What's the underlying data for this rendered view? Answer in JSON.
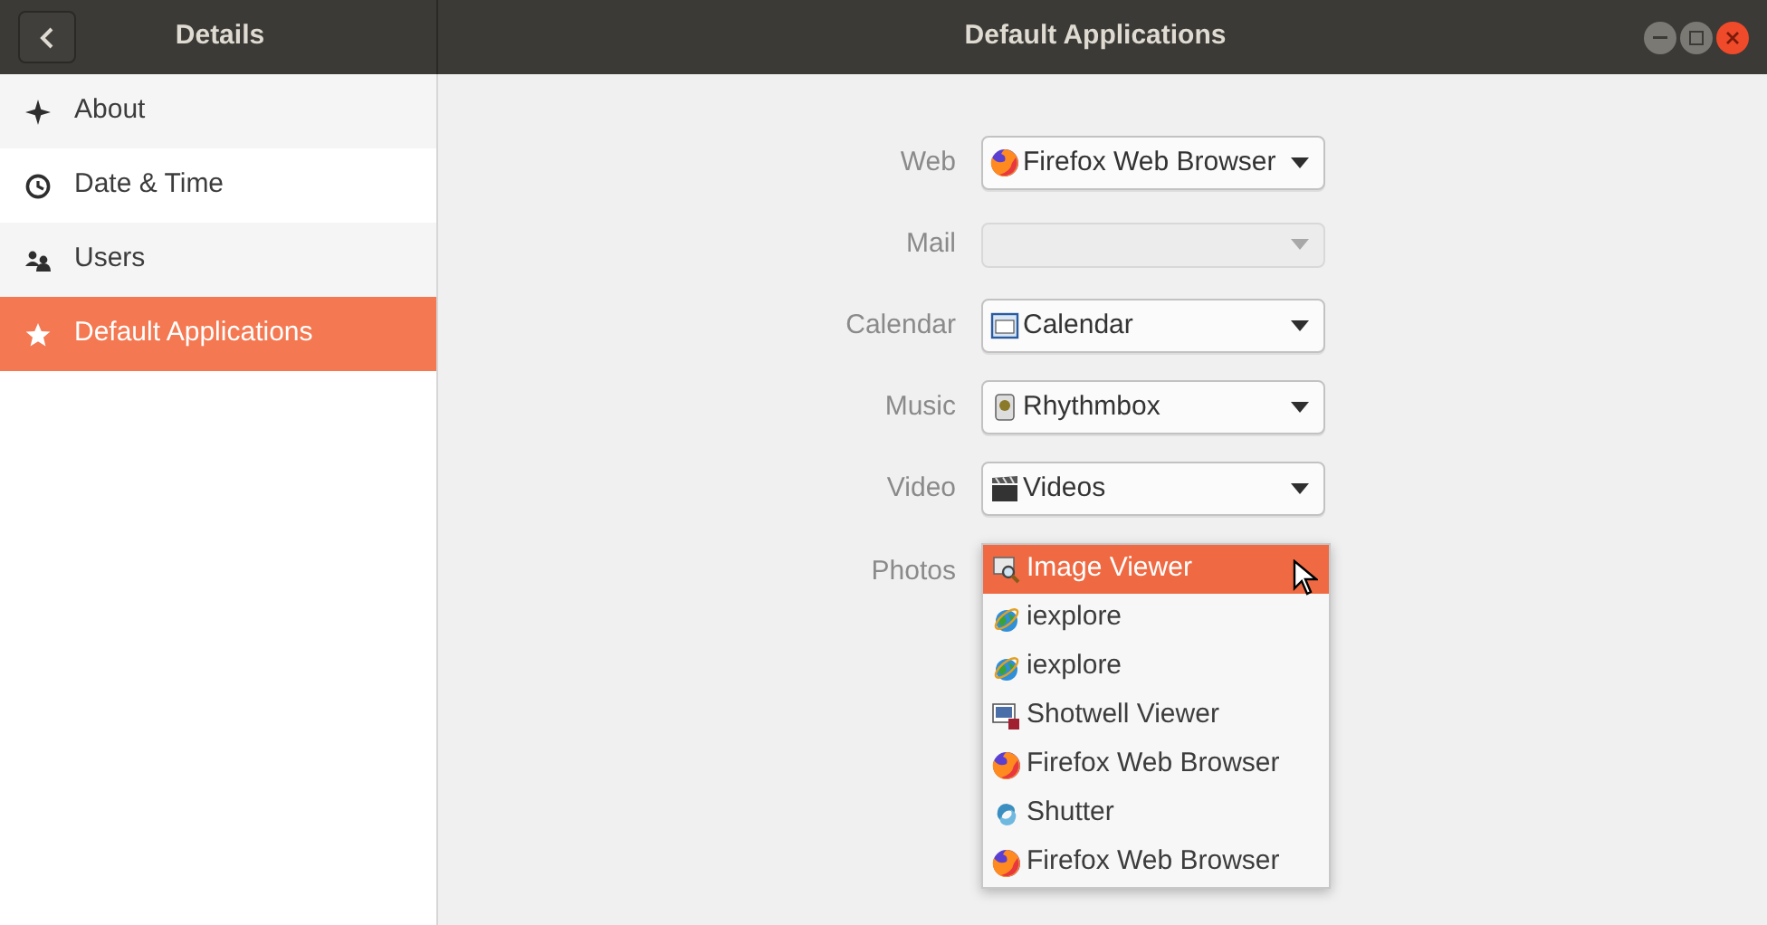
{
  "sidebar": {
    "title": "Details",
    "items": [
      {
        "label": "About",
        "kind": "sparkle",
        "selected": false
      },
      {
        "label": "Date & Time",
        "kind": "clock",
        "selected": false
      },
      {
        "label": "Users",
        "kind": "people",
        "selected": false
      },
      {
        "label": "Default Applications",
        "kind": "star",
        "selected": true
      }
    ]
  },
  "window": {
    "title": "Default Applications"
  },
  "settings": [
    {
      "label": "Web",
      "value": "Firefox Web Browser",
      "kind": "globe",
      "disabled": false
    },
    {
      "label": "Mail",
      "disabled": true
    },
    {
      "label": "Calendar",
      "value": "Calendar",
      "kind": "calendar",
      "disabled": false
    },
    {
      "label": "Music",
      "value": "Rhythmbox",
      "kind": "speaker",
      "disabled": false
    },
    {
      "label": "Video",
      "value": "Videos",
      "kind": "clapper",
      "disabled": false
    }
  ],
  "photos": {
    "label": "Photos",
    "options": [
      {
        "label": "Image Viewer",
        "kind": "magnifier",
        "selected": true
      },
      {
        "label": "iexplore",
        "kind": "earth",
        "selected": false
      },
      {
        "label": "iexplore",
        "kind": "earth",
        "selected": false
      },
      {
        "label": "Shotwell Viewer",
        "kind": "picture",
        "selected": false
      },
      {
        "label": "Firefox Web Browser",
        "kind": "globe",
        "selected": false
      },
      {
        "label": "Shutter",
        "kind": "swirl",
        "selected": false
      },
      {
        "label": "Firefox Web Browser",
        "kind": "globe",
        "selected": false
      }
    ]
  }
}
